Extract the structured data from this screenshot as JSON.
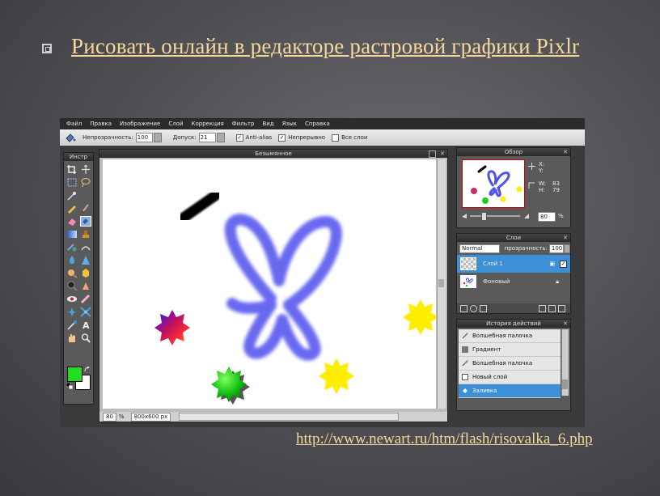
{
  "slide": {
    "title": "Рисовать онлайн в редакторе растровой графики Pixlr",
    "url": "http://www.newart.ru/htm/flash/risovalka_6.php"
  },
  "app": {
    "menu": [
      "Файл",
      "Правка",
      "Изображение",
      "Слой",
      "Коррекция",
      "Фильтр",
      "Вид",
      "Язык",
      "Справка"
    ],
    "options": {
      "opacity_label": "Непрозрачность:",
      "opacity_value": "100",
      "tolerance_label": "Допуск:",
      "tolerance_value": "21",
      "antialias_label": "Anti-alias",
      "antialias_checked": true,
      "contiguous_label": "Непрерывно",
      "contiguous_checked": true,
      "all_layers_label": "Все слои",
      "all_layers_checked": false
    },
    "tools_panel": {
      "title": "Инстр"
    },
    "canvas": {
      "title": "Безымянное",
      "zoom": "80",
      "zoom_unit": "%",
      "size": "800x600 px"
    },
    "navigator": {
      "title": "Обзор",
      "x_label": "X:",
      "y_label": "Y:",
      "w_label": "W:",
      "w_value": "83",
      "h_label": "H:",
      "h_value": "79",
      "zoom_value": "80",
      "zoom_unit": "%"
    },
    "layers": {
      "title": "Слои",
      "blend_mode": "Normal",
      "opacity_label": "прозрачность:",
      "opacity_value": "100",
      "items": [
        {
          "name": "Слой 1",
          "selected": true
        },
        {
          "name": "Фоновый",
          "selected": false
        }
      ]
    },
    "history": {
      "title": "История действий",
      "items": [
        {
          "label": "Волшебная палочка",
          "selected": false
        },
        {
          "label": "Градиент",
          "selected": false
        },
        {
          "label": "Волшебная палочка",
          "selected": false
        },
        {
          "label": "Новый слой",
          "selected": false
        },
        {
          "label": "Заливка",
          "selected": true
        }
      ]
    },
    "colors": {
      "foreground": "#22dd22",
      "background": "#ffffff",
      "accent": "#3d8fd6"
    }
  }
}
